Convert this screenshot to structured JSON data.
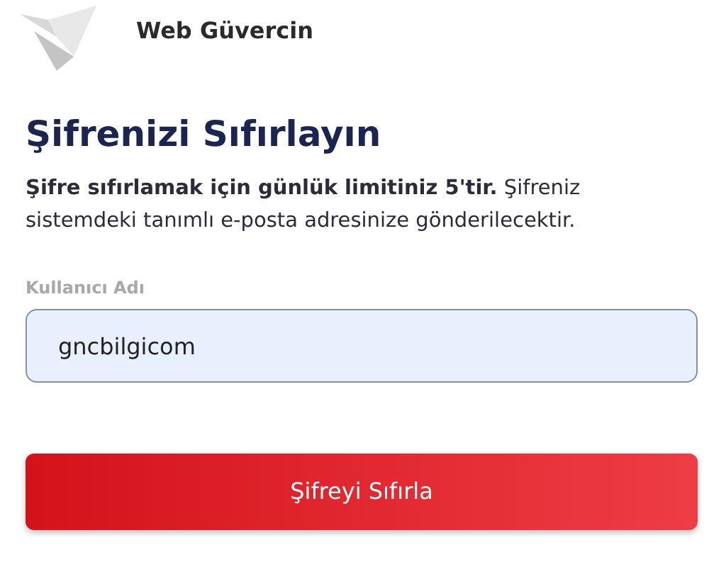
{
  "brand": {
    "name": "Web Güvercin"
  },
  "title": "Şifrenizi Sıfırlayın",
  "description": "**Şifre sıfırlamak için günlük limitiniz 5'tir.** Şifreniz sistemdeki tanımlı e-posta adresinize gönderilecektir.",
  "username": {
    "label": "Kullanıcı Adı",
    "value": "gncbilgicom"
  },
  "submit": {
    "label": "Şifreyi Sıfırla"
  }
}
